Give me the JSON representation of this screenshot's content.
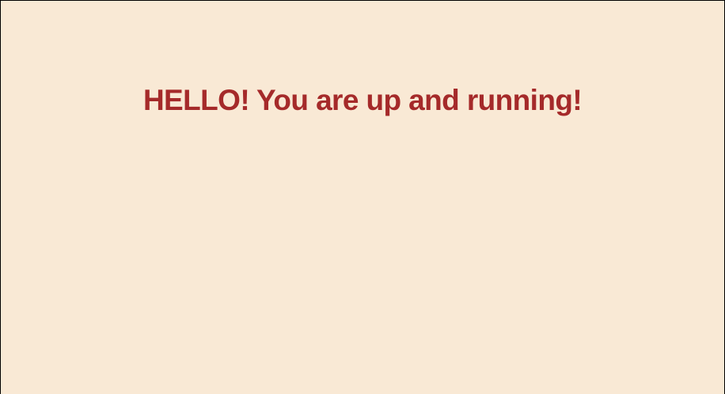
{
  "page": {
    "greeting": "HELLO! You are up and running!"
  },
  "colors": {
    "background": "#f9e9d5",
    "text": "#a52a2a",
    "border": "#000000"
  }
}
